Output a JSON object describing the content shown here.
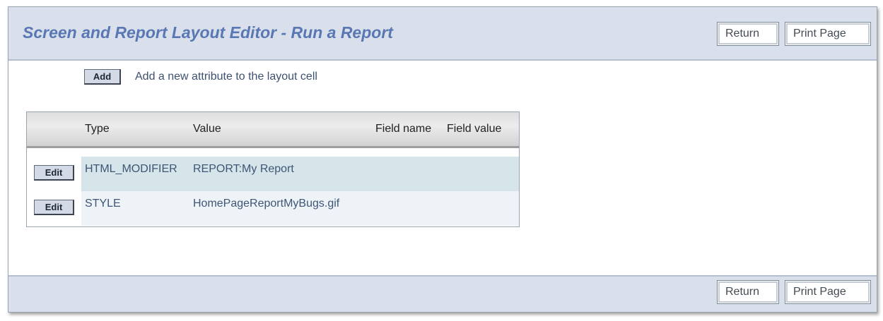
{
  "header": {
    "title": "Screen and Report Layout Editor - Run a Report",
    "return_label": "Return",
    "print_label": "Print Page"
  },
  "add_section": {
    "button_label": "Add",
    "description": "Add a new attribute to the layout cell"
  },
  "table": {
    "columns": {
      "type": "Type",
      "value": "Value",
      "field_name": "Field name",
      "field_value": "Field value"
    },
    "rows": [
      {
        "edit_label": "Edit",
        "type": "HTML_MODIFIER",
        "value": "REPORT:My Report",
        "field_name": "",
        "field_value": ""
      },
      {
        "edit_label": "Edit",
        "type": "STYLE",
        "value": "HomePageReportMyBugs.gif",
        "field_name": "",
        "field_value": ""
      }
    ]
  },
  "footer": {
    "return_label": "Return",
    "print_label": "Print Page"
  },
  "colors": {
    "title": "#5877b3",
    "header_bar": "#d9e0ec",
    "row_highlight": "#d5e5ea",
    "row_alt": "#eef3f8"
  }
}
